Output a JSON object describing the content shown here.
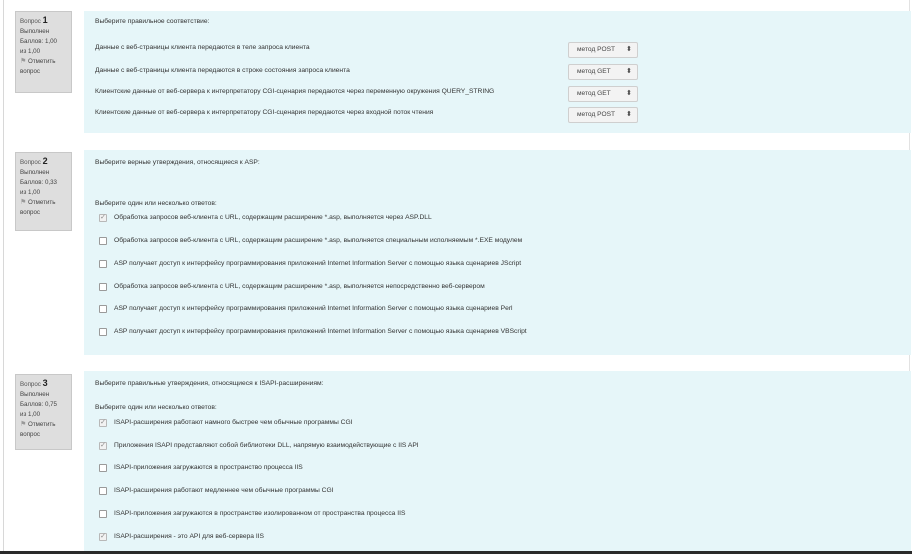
{
  "questions": [
    {
      "number_prefix": "Вопрос",
      "number": "1",
      "status": "Выполнен",
      "score_line1": "Баллов: 1,00",
      "score_line2": "из 1,00",
      "flag_line1": "Отметить",
      "flag_line2": "вопрос",
      "prompt": "Выберите правильное соответствие:",
      "rows": [
        {
          "text": "Данные с веб-страницы клиента передаются в теле запроса клиента",
          "selected": "метод POST"
        },
        {
          "text": "Данные с веб-страницы клиента передаются в строке состояния запроса клиента",
          "selected": "метод GET"
        },
        {
          "text": "Клиентские данные от веб-сервера к интерпретатору CGI-сценария передаются через переменную окружения QUERY_STRING",
          "selected": "метод GET"
        },
        {
          "text": "Клиентские данные от веб-сервера к интерпретатору CGI-сценария передаются через входной поток чтения",
          "selected": "метод POST"
        }
      ]
    },
    {
      "number_prefix": "Вопрос",
      "number": "2",
      "status": "Выполнен",
      "score_line1": "Баллов: 0,33",
      "score_line2": "из 1,00",
      "flag_line1": "Отметить",
      "flag_line2": "вопрос",
      "prompt": "Выберите верные утверждения, относящиеся к ASP:",
      "instruction": "Выберите один или несколько ответов:",
      "options": [
        {
          "text": "Обработка запросов веб-клиента с URL, содержащим расширение *.asp, выполняется через ASP.DLL",
          "checked": true
        },
        {
          "text": "Обработка запросов веб-клиента с URL, содержащим расширение *.asp, выполняется специальным исполняемым *.EXE модулем",
          "checked": false
        },
        {
          "text": "ASP получает доступ к интерфейсу программирования приложений Internet Information Server с помощью языка сценариев JScript",
          "checked": false
        },
        {
          "text": "Обработка запросов веб-клиента с URL, содержащим расширение *.asp, выполняется непосредственно веб-сервером",
          "checked": false
        },
        {
          "text": "ASP получает доступ к интерфейсу программирования приложений Internet Information Server с помощью языка сценариев Perl",
          "checked": false
        },
        {
          "text": "ASP получает доступ к интерфейсу программирования приложений Internet Information Server с помощью языка сценариев VBScript",
          "checked": false
        }
      ]
    },
    {
      "number_prefix": "Вопрос",
      "number": "3",
      "status": "Выполнен",
      "score_line1": "Баллов: 0,75",
      "score_line2": "из 1,00",
      "flag_line1": "Отметить",
      "flag_line2": "вопрос",
      "prompt": "Выберите правильные утверждения, относящиеся к ISAPI-расширениям:",
      "instruction": "Выберите один или несколько ответов:",
      "options": [
        {
          "text": "ISAPI-расширения работают намного быстрее чем обычные программы CGI",
          "checked": true
        },
        {
          "text": "Приложения ISAPI представляют собой библиотеки DLL, напрямую взаимодействующие с IIS API",
          "checked": true
        },
        {
          "text": "ISAPI-приложения загружаются в пространство процесса IIS",
          "checked": false
        },
        {
          "text": "ISAPI-расширения работают медленнее чем обычные программы CGI",
          "checked": false
        },
        {
          "text": "ISAPI-приложения загружаются в пространстве изолированном от пространства процесса IIS",
          "checked": false
        },
        {
          "text": "ISAPI-расширения - это API для веб-сервера IIS",
          "checked": true
        }
      ]
    }
  ],
  "icons": {
    "flag": "flag-icon",
    "dropdown": "select-arrows-icon",
    "check": "checkmark-icon"
  },
  "colors": {
    "question_bg": "#e6f6f9",
    "info_bg": "#dedede"
  }
}
